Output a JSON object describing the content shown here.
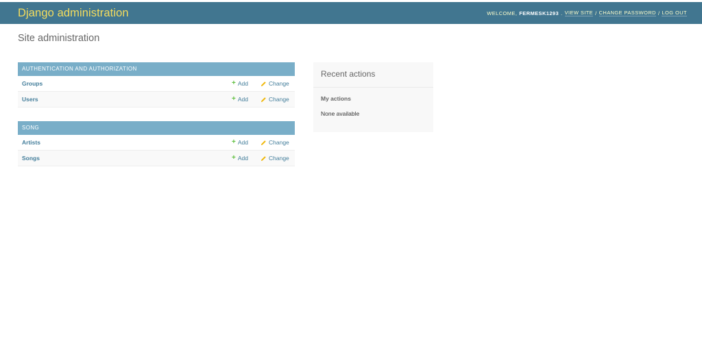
{
  "header": {
    "branding": "Django administration",
    "welcome": "WELCOME,",
    "username": "FERMESK1293",
    "view_site": "VIEW SITE",
    "change_password": "CHANGE PASSWORD",
    "log_out": "LOG OUT",
    "separator": "/"
  },
  "page": {
    "title": "Site administration"
  },
  "modules": [
    {
      "caption": "AUTHENTICATION AND AUTHORIZATION",
      "models": [
        {
          "name": "Groups",
          "add": "Add",
          "change": "Change"
        },
        {
          "name": "Users",
          "add": "Add",
          "change": "Change"
        }
      ]
    },
    {
      "caption": "SONG",
      "models": [
        {
          "name": "Artists",
          "add": "Add",
          "change": "Change"
        },
        {
          "name": "Songs",
          "add": "Add",
          "change": "Change"
        }
      ]
    }
  ],
  "recent_actions": {
    "title": "Recent actions",
    "subtitle": "My actions",
    "empty": "None available"
  },
  "icons": {
    "add": "plus-icon",
    "change": "pencil-icon"
  },
  "colors": {
    "header_bg": "#417690",
    "branding": "#f5dd5d",
    "module_caption_bg": "#79aec8",
    "link": "#447e9b",
    "add_icon": "#5fbf3f",
    "change_icon": "#efb80b"
  }
}
